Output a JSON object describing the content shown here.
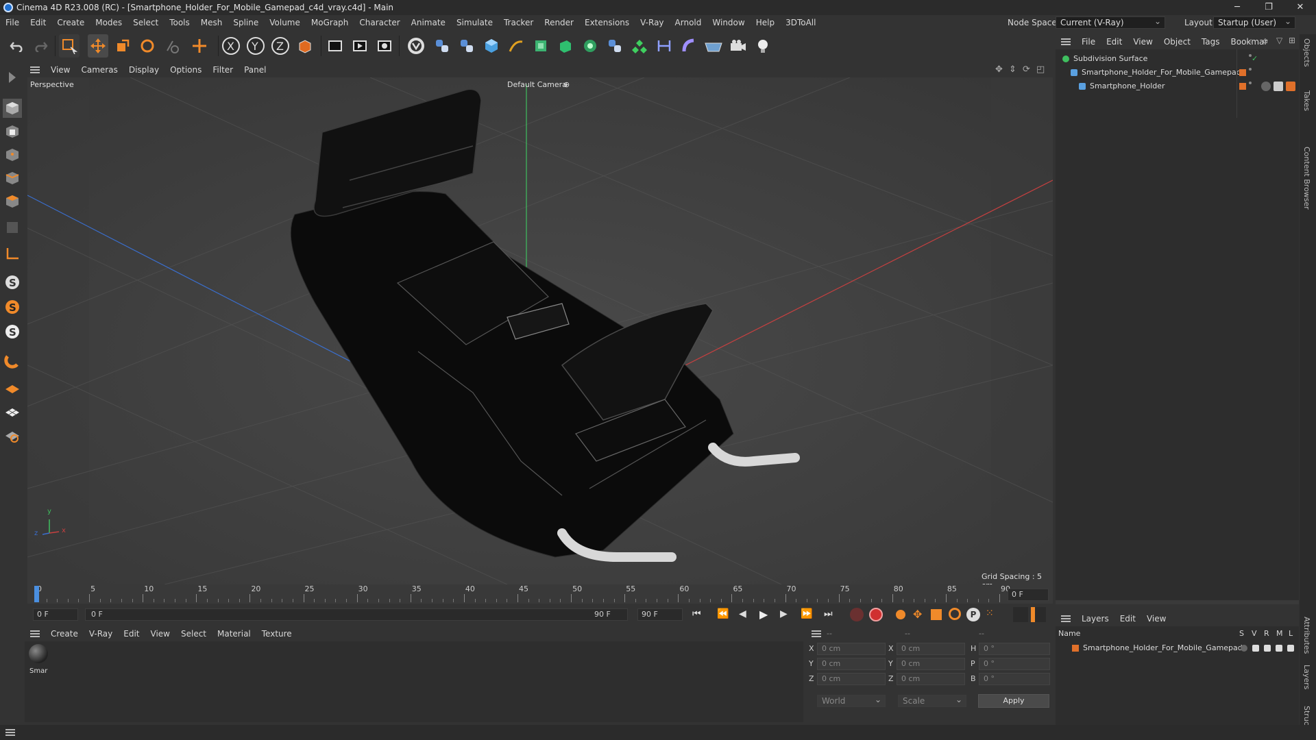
{
  "window": {
    "title": "Cinema 4D R23.008 (RC) - [Smartphone_Holder_For_Mobile_Gamepad_c4d_vray.c4d] - Main",
    "minimize": "─",
    "maximize": "❐",
    "close": "✕"
  },
  "menubar": {
    "items": [
      "File",
      "Edit",
      "Create",
      "Modes",
      "Select",
      "Tools",
      "Mesh",
      "Spline",
      "Volume",
      "MoGraph",
      "Character",
      "Animate",
      "Simulate",
      "Tracker",
      "Render",
      "Extensions",
      "V-Ray",
      "Arnold",
      "Window",
      "Help",
      "3DToAll"
    ],
    "node_space_label": "Node Space:",
    "node_space_value": "Current (V-Ray)",
    "layout_label": "Layout:",
    "layout_value": "Startup (User)"
  },
  "viewport": {
    "menu": [
      "View",
      "Cameras",
      "Display",
      "Options",
      "Filter",
      "Panel"
    ],
    "projection": "Perspective",
    "camera": "Default Camera",
    "grid_spacing": "Grid Spacing : 5 cm",
    "axis_y": "y",
    "axis_x": "x",
    "axis_z": "z"
  },
  "timeline": {
    "ticks": [
      "0",
      "5",
      "10",
      "15",
      "20",
      "25",
      "30",
      "35",
      "40",
      "45",
      "50",
      "55",
      "60",
      "65",
      "70",
      "75",
      "80",
      "85",
      "90"
    ],
    "current_frame": "0 F"
  },
  "transport": {
    "start_field": "0 F",
    "range_start": "0 F",
    "range_end": "90 F",
    "end_field": "90 F"
  },
  "material_menu": [
    "Create",
    "V-Ray",
    "Edit",
    "View",
    "Select",
    "Material",
    "Texture"
  ],
  "material": {
    "name": "Smar"
  },
  "coords": {
    "header_dash1": "--",
    "header_dash2": "--",
    "header_dash3": "--",
    "rows": [
      {
        "l1": "X",
        "v1": "0 cm",
        "l2": "X",
        "v2": "0 cm",
        "l3": "H",
        "v3": "0 °"
      },
      {
        "l1": "Y",
        "v1": "0 cm",
        "l2": "Y",
        "v2": "0 cm",
        "l3": "P",
        "v3": "0 °"
      },
      {
        "l1": "Z",
        "v1": "0 cm",
        "l2": "Z",
        "v2": "0 cm",
        "l3": "B",
        "v3": "0 °"
      }
    ],
    "world": "World",
    "scale": "Scale",
    "apply": "Apply"
  },
  "objects_menu": [
    "File",
    "Edit",
    "View",
    "Object",
    "Tags",
    "Bookmar"
  ],
  "objects": [
    {
      "name": "Subdivision Surface"
    },
    {
      "name": "Smartphone_Holder_For_Mobile_Gamepad"
    },
    {
      "name": "Smartphone_Holder"
    }
  ],
  "layers_menu": [
    "Layers",
    "Edit",
    "View"
  ],
  "layers_header": {
    "name": "Name",
    "s": "S",
    "v": "V",
    "r": "R",
    "m": "M",
    "l": "L"
  },
  "layers": [
    {
      "name": "Smartphone_Holder_For_Mobile_Gamepad"
    }
  ],
  "side_tabs": [
    "Objects",
    "Takes",
    "Content Browser",
    "Attributes",
    "Layers",
    "Structure"
  ],
  "colors": {
    "accent": "#e0702a",
    "x_axis": "#c84040",
    "y_axis": "#3fbf5f",
    "z_axis": "#3a6fd0"
  }
}
